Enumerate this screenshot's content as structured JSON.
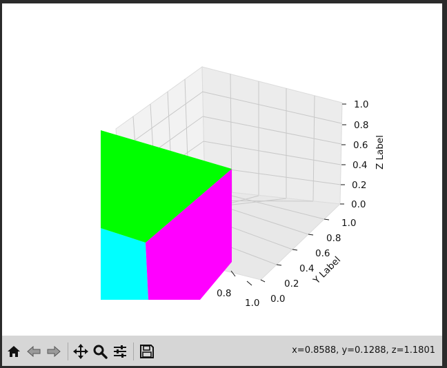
{
  "figure": {
    "z_axis": {
      "label": "Z Label",
      "ticks": [
        "1.0",
        "0.8",
        "0.6",
        "0.4",
        "0.2",
        "0.0"
      ]
    },
    "y_axis": {
      "label": "Y Label",
      "ticks": [
        "1.0",
        "0.8",
        "0.6",
        "0.4",
        "0.2",
        "0.0"
      ]
    },
    "x_axis": {
      "label": "",
      "ticks": [
        "0.8",
        "1.0"
      ]
    },
    "faces": {
      "top_color": "#00ff00",
      "side_color": "#ff00ff",
      "front_color": "#00ffff"
    }
  },
  "toolbar": {
    "buttons": [
      {
        "name": "home-icon",
        "title": "Home"
      },
      {
        "name": "back-icon",
        "title": "Back"
      },
      {
        "name": "forward-icon",
        "title": "Forward"
      },
      {
        "name": "pan-icon",
        "title": "Pan"
      },
      {
        "name": "zoom-icon",
        "title": "Zoom"
      },
      {
        "name": "configure-subplots-icon",
        "title": "Configure subplots"
      },
      {
        "name": "save-icon",
        "title": "Save"
      }
    ],
    "coordinates": "x=0.8588, y=0.1288, z=1.1801"
  }
}
